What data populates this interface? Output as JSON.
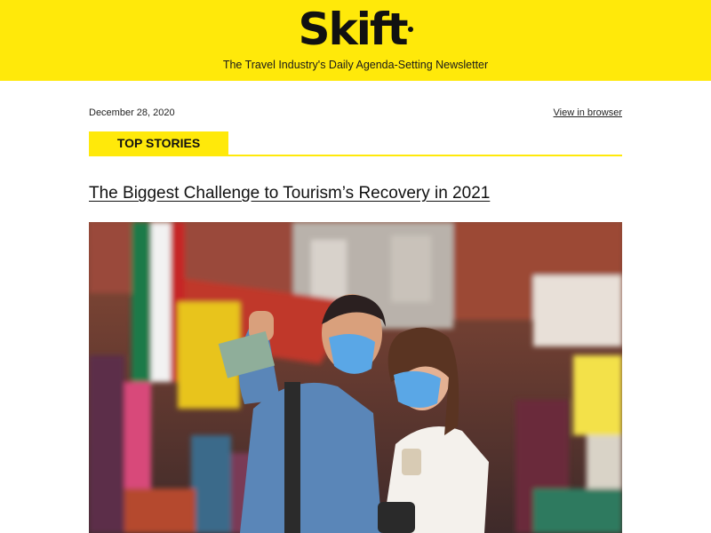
{
  "header": {
    "logo_text": "Skift",
    "tagline": "The Travel Industry's Daily Agenda-Setting Newsletter",
    "background_color": "#ffe90a"
  },
  "meta": {
    "date": "December 28, 2020",
    "view_in_browser": "View in browser"
  },
  "section": {
    "label": "TOP STORIES"
  },
  "story": {
    "headline": "The Biggest Challenge to Tourism’s Recovery in 2021",
    "image_alt": "photo of a couple wearing blue face masks at a colorful outdoor market"
  }
}
